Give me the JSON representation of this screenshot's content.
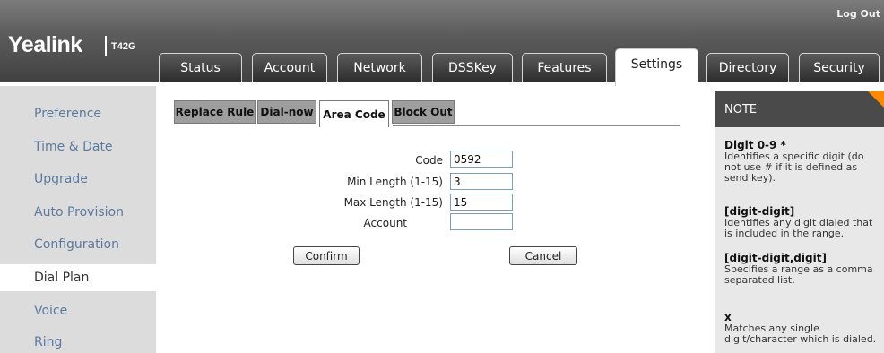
{
  "header": {
    "logo": "Yealink",
    "model": "T42G",
    "logout": "Log Out"
  },
  "tabs": [
    {
      "label": "Status"
    },
    {
      "label": "Account"
    },
    {
      "label": "Network"
    },
    {
      "label": "DSSKey"
    },
    {
      "label": "Features"
    },
    {
      "label": "Settings",
      "active": true
    },
    {
      "label": "Directory"
    },
    {
      "label": "Security"
    }
  ],
  "sidebar": {
    "items": [
      {
        "label": "Preference"
      },
      {
        "label": "Time & Date"
      },
      {
        "label": "Upgrade"
      },
      {
        "label": "Auto Provision"
      },
      {
        "label": "Configuration"
      },
      {
        "label": "Dial Plan",
        "active": true
      },
      {
        "label": "Voice"
      },
      {
        "label": "Ring"
      }
    ]
  },
  "subtabs": [
    {
      "label": "Replace Rule"
    },
    {
      "label": "Dial-now"
    },
    {
      "label": "Area Code",
      "active": true
    },
    {
      "label": "Block Out"
    }
  ],
  "form": {
    "code": {
      "label": "Code",
      "value": "0592"
    },
    "min_length": {
      "label": "Min Length (1-15)",
      "value": "3"
    },
    "max_length": {
      "label": "Max Length (1-15)",
      "value": "15"
    },
    "account": {
      "label": "Account",
      "value": ""
    },
    "confirm_label": "Confirm",
    "cancel_label": "Cancel"
  },
  "note": {
    "title": "NOTE",
    "entries": [
      {
        "title": "Digit 0-9 *",
        "desc": "Identifies a specific digit (do not use # if it is defined as send key)."
      },
      {
        "title": "[digit-digit]",
        "desc": "Identifies any digit dialed that is included in the range."
      },
      {
        "title": "[digit-digit,digit]",
        "desc": "Specifies a range as a comma separated list."
      },
      {
        "title": "x",
        "desc": "Matches any single digit/character which is dialed."
      }
    ]
  },
  "colors": {
    "accent": "#ff8a00",
    "sidebar_link": "#5b7aa0"
  }
}
